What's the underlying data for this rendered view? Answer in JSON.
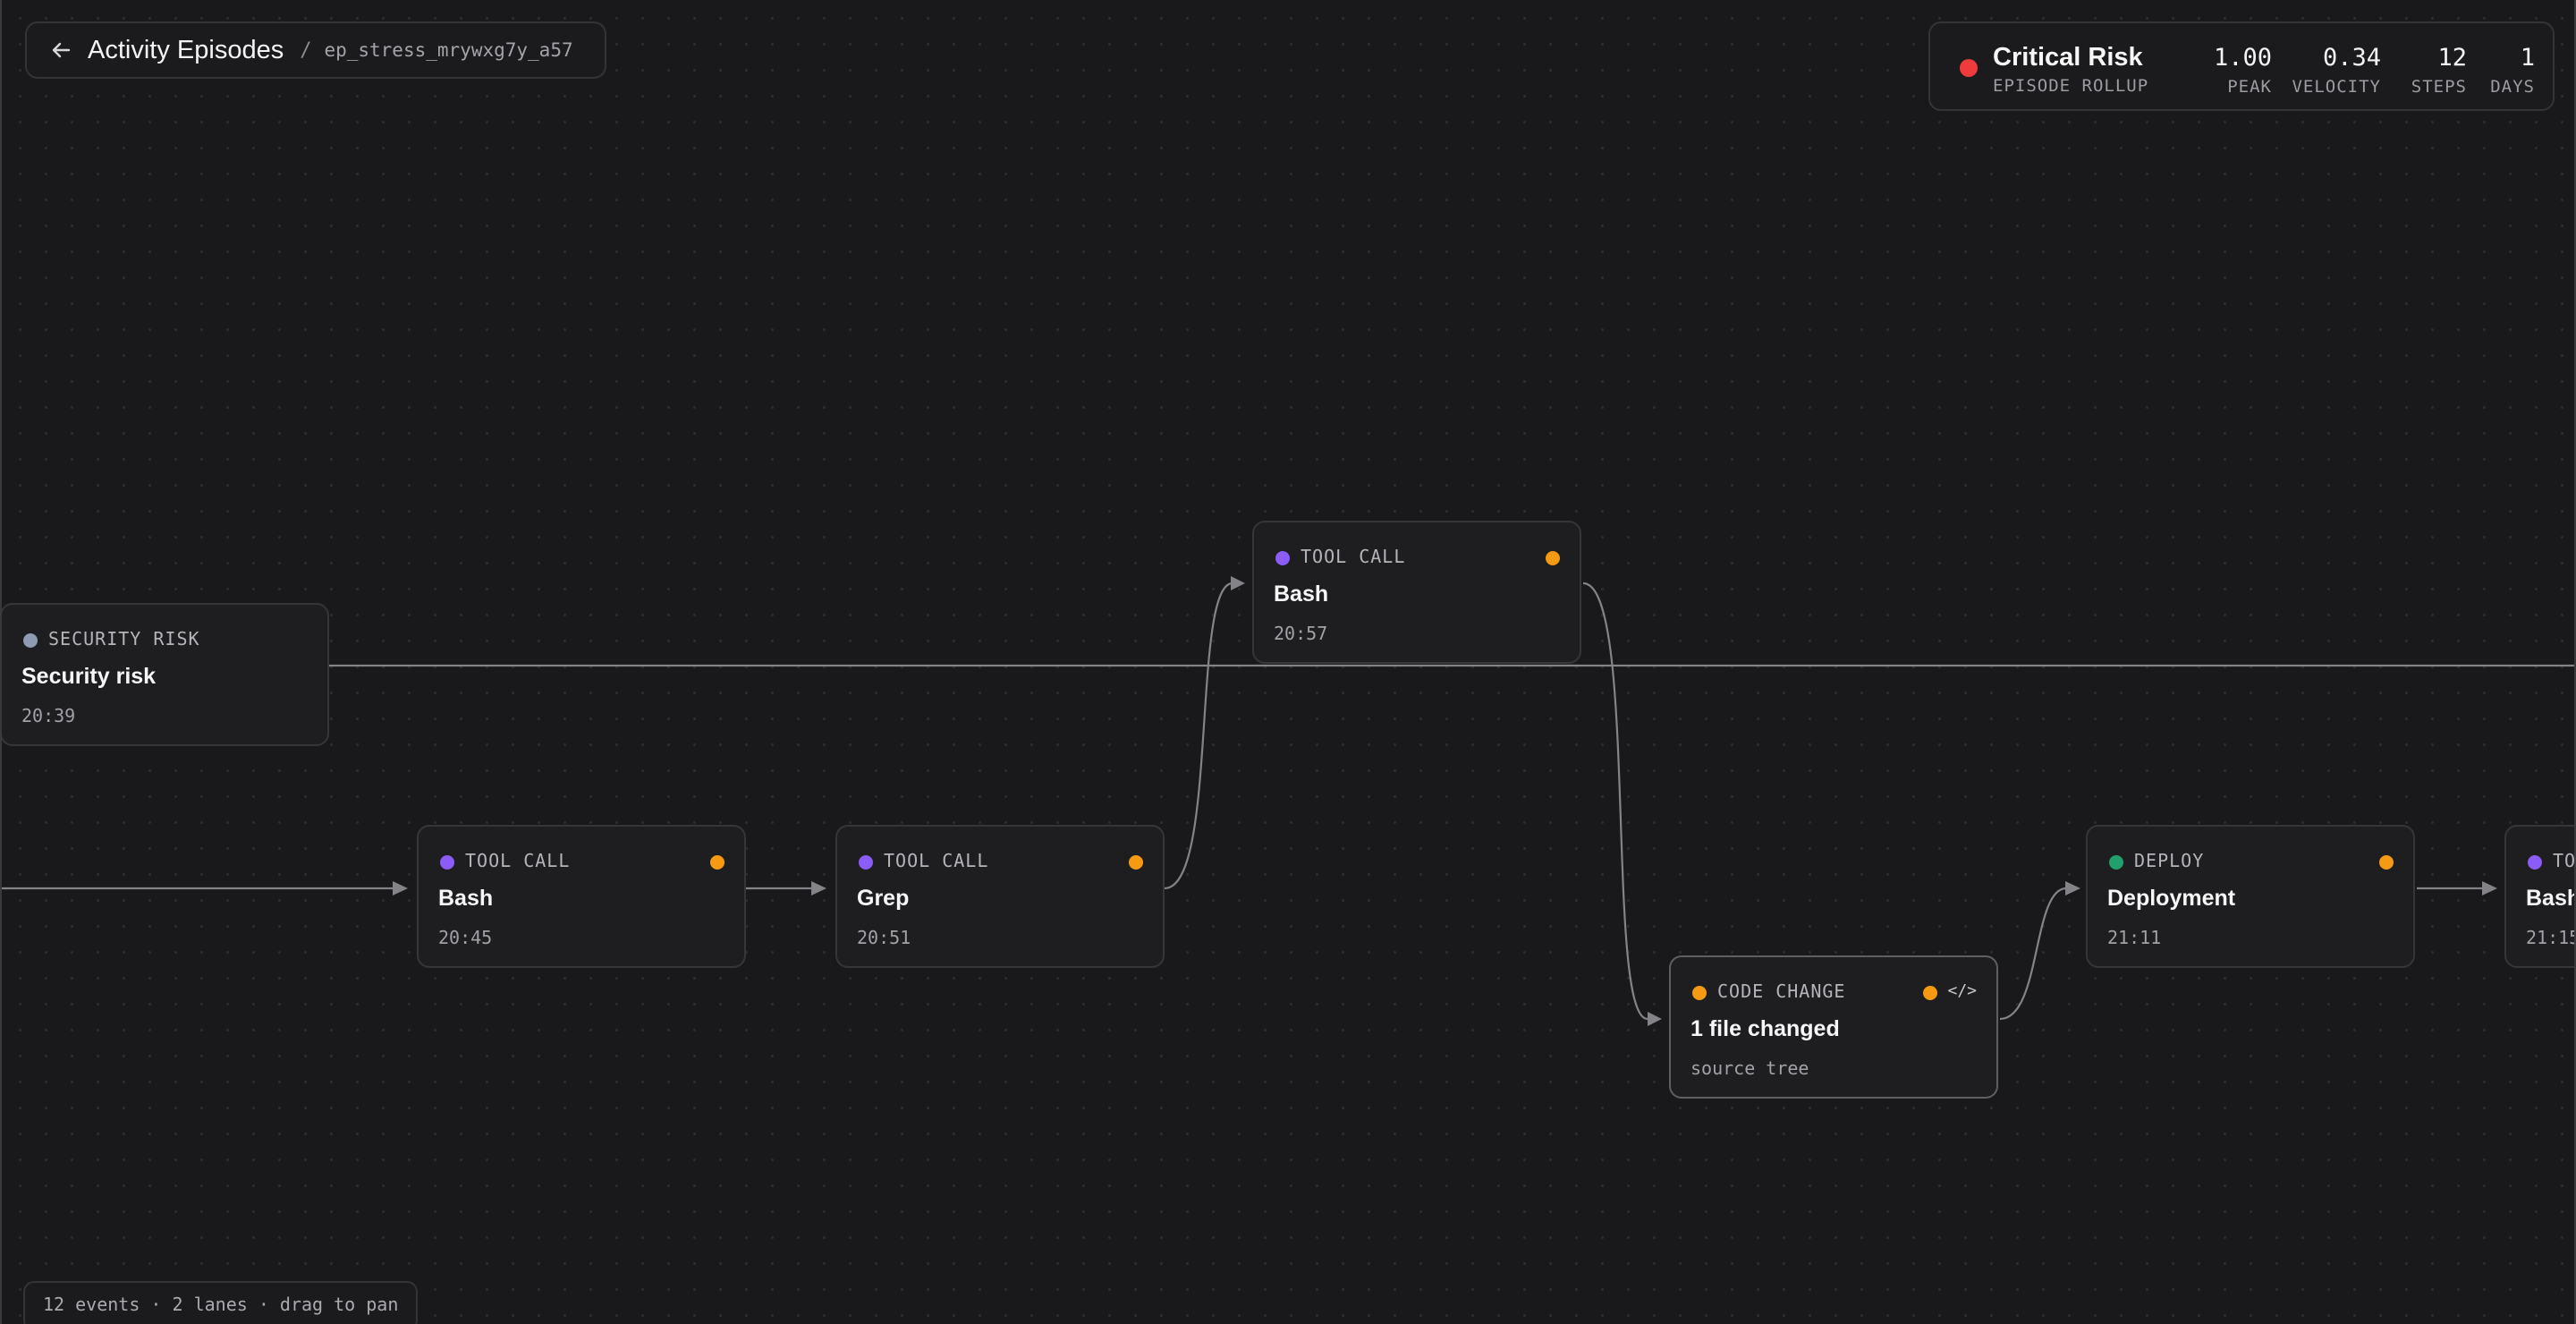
{
  "header": {
    "back_label": "back",
    "title": "Activity Episodes",
    "separator": "/",
    "episode_id": "ep_stress_mrywxg7y_a57"
  },
  "risk": {
    "level": "Critical Risk",
    "subtitle": "EPISODE ROLLUP",
    "color": "#ef3b3b",
    "stats": [
      {
        "value": "1.00",
        "label": "PEAK"
      },
      {
        "value": "0.34",
        "label": "VELOCITY"
      },
      {
        "value": "12",
        "label": "STEPS"
      },
      {
        "value": "1",
        "label": "DAYS"
      }
    ]
  },
  "nodes": [
    {
      "kind": "SECURITY RISK",
      "title": "Security risk",
      "meta": "20:39",
      "kind_color": "#8f9bb3",
      "status": false
    },
    {
      "kind": "TOOL CALL",
      "title": "Bash",
      "meta": "20:45",
      "kind_color": "#8b5cf6",
      "status": true
    },
    {
      "kind": "TOOL CALL",
      "title": "Grep",
      "meta": "20:51",
      "kind_color": "#8b5cf6",
      "status": true
    },
    {
      "kind": "TOOL CALL",
      "title": "Bash",
      "meta": "20:57",
      "kind_color": "#8b5cf6",
      "status": true
    },
    {
      "kind": "CODE CHANGE",
      "title": "1 file changed",
      "meta": "source tree",
      "kind_color": "#f59a12",
      "status": true,
      "icon": "</>"
    },
    {
      "kind": "DEPLOY",
      "title": "Deployment",
      "meta": "21:11",
      "kind_color": "#22a06b",
      "status": true
    },
    {
      "kind": "TOOL CALL",
      "title": "Bash",
      "meta": "21:15",
      "kind_color": "#8b5cf6",
      "status": true
    }
  ],
  "status_color": "#f59a12",
  "footer": {
    "summary": "12 events · 2 lanes · drag to pan"
  }
}
